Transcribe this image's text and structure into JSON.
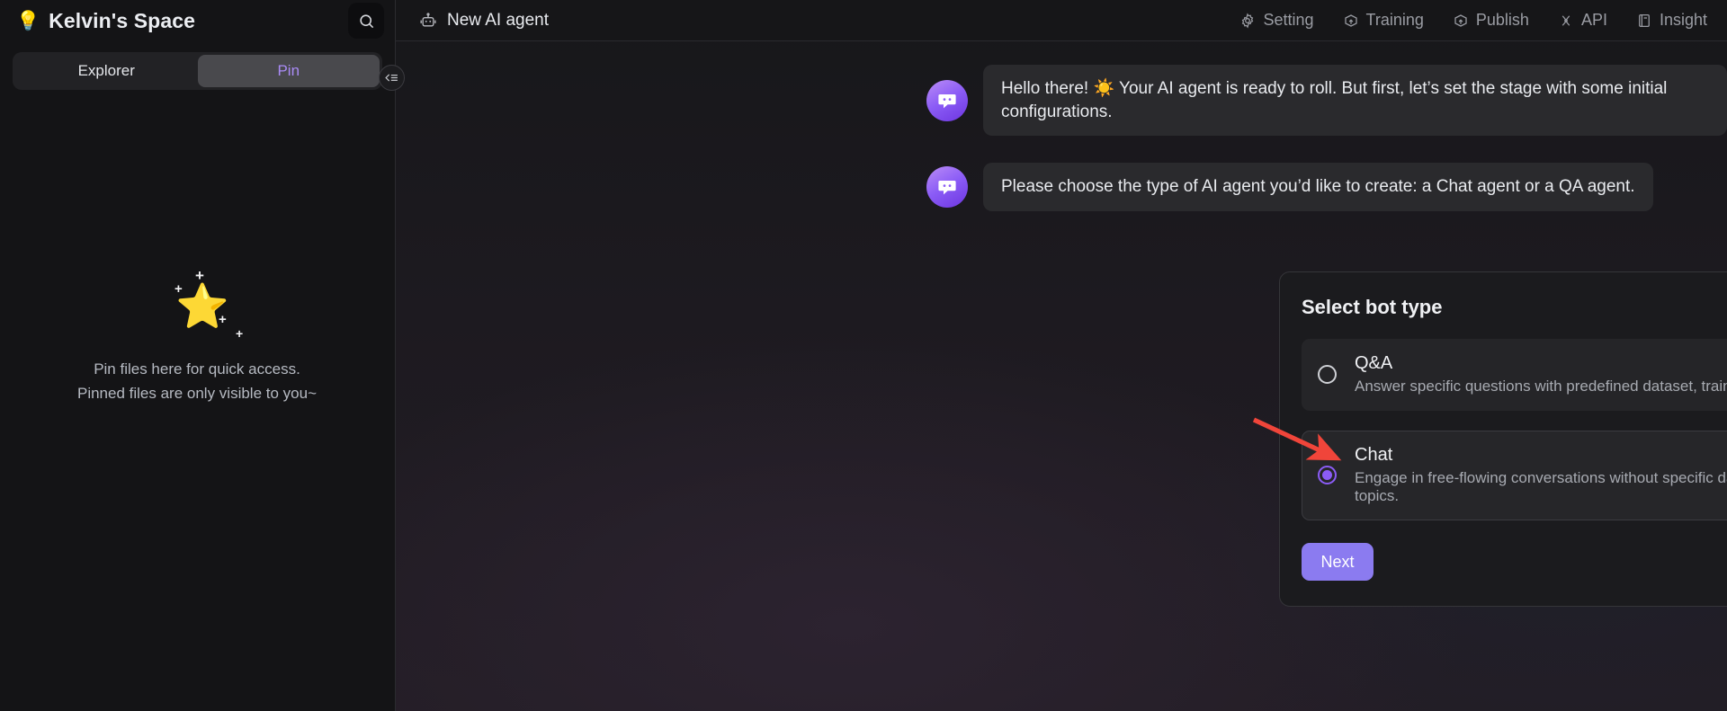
{
  "sidebar": {
    "logo_icon": "lightbulb-icon",
    "title": "Kelvin's Space",
    "search_icon": "search-icon",
    "tabs": [
      {
        "label": "Explorer",
        "active": false
      },
      {
        "label": "Pin",
        "active": true
      }
    ],
    "empty_state": {
      "icon": "star-sparkle-icon",
      "line1": "Pin files here for quick access.",
      "line2": "Pinned files are only visible to you~"
    },
    "collapse_icon": "collapse-sidebar-icon"
  },
  "topbar": {
    "tab": {
      "icon": "robot-icon",
      "label": "New AI agent"
    },
    "nav": [
      {
        "label": "Setting",
        "icon": "gear-icon"
      },
      {
        "label": "Training",
        "icon": "box-upload-icon"
      },
      {
        "label": "Publish",
        "icon": "box-upload-icon"
      },
      {
        "label": "API",
        "icon": "plug-icon"
      },
      {
        "label": "Insight",
        "icon": "document-icon"
      }
    ]
  },
  "chat": {
    "messages": [
      {
        "avatar_icon": "chat-bubble-icon",
        "text": "Hello there! ☀️ Your AI agent is ready to roll. But first, let’s set the stage with some initial configurations."
      },
      {
        "avatar_icon": "chat-bubble-icon",
        "text": "Please choose the type of AI agent you’d like to create: a Chat agent or a QA agent."
      }
    ]
  },
  "panel": {
    "title": "Select bot type",
    "options": [
      {
        "name": "Q&A",
        "desc": "Answer specific questions with predefined dataset, train and customize easily.",
        "selected": false
      },
      {
        "name": "Chat",
        "desc": "Engage in free-flowing conversations without specific dataset, adaptable to various topics.",
        "selected": true
      }
    ],
    "next_label": "Next"
  },
  "annotation": {
    "type": "red-arrow",
    "points_to": "chat-radio"
  },
  "colors": {
    "accent": "#8b5cf6",
    "button": "#8b7bf0",
    "star": "#f5a623",
    "arrow": "#f0453a",
    "sidebar_bg": "#141416",
    "panel_bg": "#1b1b1e"
  }
}
